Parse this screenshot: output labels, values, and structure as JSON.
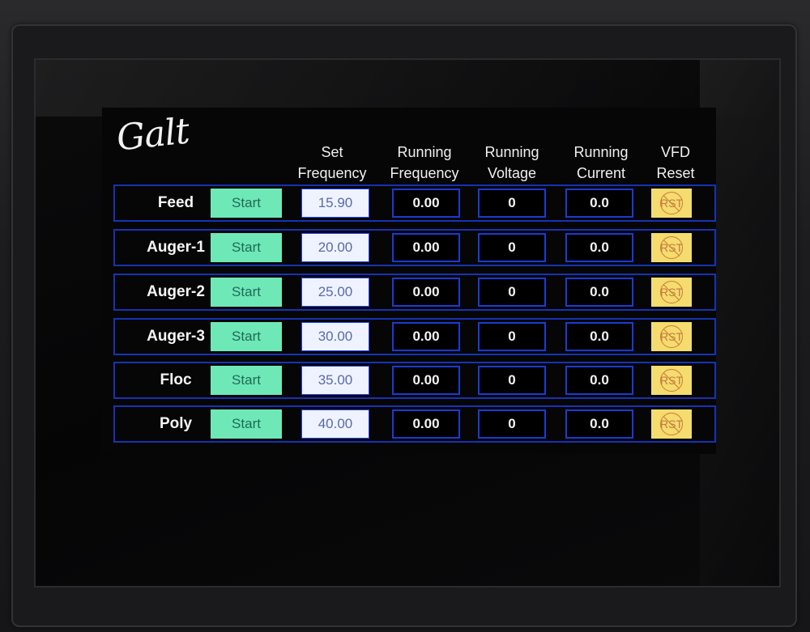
{
  "logo": "Galt",
  "headers": {
    "set_frequency": [
      "Set",
      "Frequency"
    ],
    "running_frequency": [
      "Running",
      "Frequency"
    ],
    "running_voltage": [
      "Running",
      "Voltage"
    ],
    "running_current": [
      "Running",
      "Current"
    ],
    "vfd_reset": [
      "VFD",
      "Reset"
    ]
  },
  "rows": [
    {
      "label": "Feed",
      "start": "Start",
      "set": "15.90",
      "freq": "0.00",
      "volt": "0",
      "curr": "0.0",
      "reset": "RST"
    },
    {
      "label": "Auger-1",
      "start": "Start",
      "set": "20.00",
      "freq": "0.00",
      "volt": "0",
      "curr": "0.0",
      "reset": "RST"
    },
    {
      "label": "Auger-2",
      "start": "Start",
      "set": "25.00",
      "freq": "0.00",
      "volt": "0",
      "curr": "0.0",
      "reset": "RST"
    },
    {
      "label": "Auger-3",
      "start": "Start",
      "set": "30.00",
      "freq": "0.00",
      "volt": "0",
      "curr": "0.0",
      "reset": "RST"
    },
    {
      "label": "Floc",
      "start": "Start",
      "set": "35.00",
      "freq": "0.00",
      "volt": "0",
      "curr": "0.0",
      "reset": "RST"
    },
    {
      "label": "Poly",
      "start": "Start",
      "set": "40.00",
      "freq": "0.00",
      "volt": "0",
      "curr": "0.0",
      "reset": "RST"
    }
  ],
  "colors": {
    "start_button": "#6ee8b7",
    "set_field": "#eef3ff",
    "reset_button": "#f4dc6e",
    "row_border": "#1633b3",
    "screen_bg": "#060606"
  }
}
